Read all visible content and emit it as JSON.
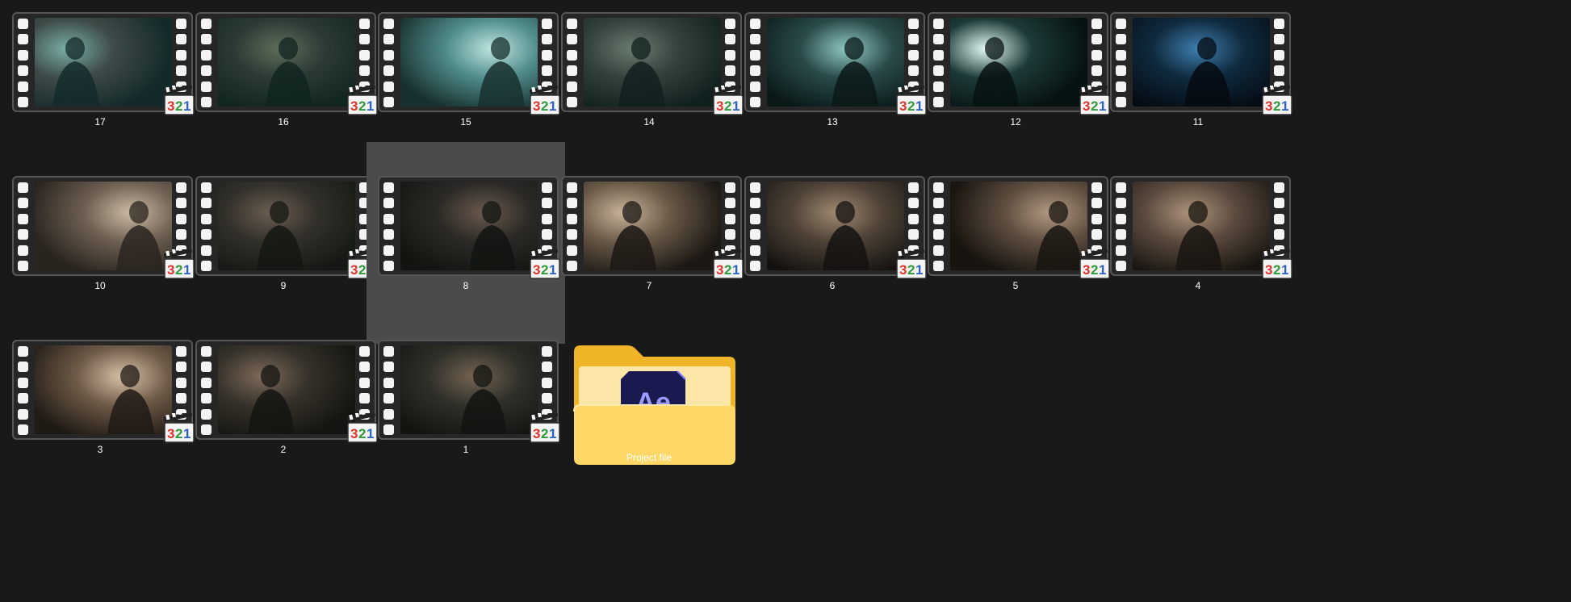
{
  "explorer": {
    "view": "large-icons",
    "items": [
      {
        "name": "17",
        "type": "video",
        "icon": "media-player-classic-321-icon",
        "tone": [
          "#142a2a",
          "#3e4a48",
          "#7ab0a8"
        ]
      },
      {
        "name": "16",
        "type": "video",
        "icon": "media-player-classic-321-icon",
        "tone": [
          "#102420",
          "#2b3a34",
          "#5e6e5a"
        ]
      },
      {
        "name": "15",
        "type": "video",
        "icon": "media-player-classic-321-icon",
        "tone": [
          "#18302f",
          "#4f8c8a",
          "#bfe6e2"
        ]
      },
      {
        "name": "14",
        "type": "video",
        "icon": "media-player-classic-321-icon",
        "tone": [
          "#10201e",
          "#33423c",
          "#6a7c70"
        ]
      },
      {
        "name": "13",
        "type": "video",
        "icon": "media-player-classic-321-icon",
        "tone": [
          "#0a1818",
          "#2a4a4a",
          "#8fc9c4"
        ]
      },
      {
        "name": "12",
        "type": "video",
        "icon": "media-player-classic-321-icon",
        "tone": [
          "#061212",
          "#1d3a38",
          "#e4fbf6"
        ]
      },
      {
        "name": "11",
        "type": "video",
        "icon": "media-player-classic-321-icon",
        "tone": [
          "#050b12",
          "#0f2a3e",
          "#3f7fb0"
        ]
      },
      {
        "name": "10",
        "type": "video",
        "icon": "media-player-classic-321-icon",
        "tone": [
          "#2a241e",
          "#6e6052",
          "#cdbba6"
        ]
      },
      {
        "name": "9",
        "type": "video",
        "icon": "media-player-classic-321-icon",
        "tone": [
          "#141812",
          "#32302a",
          "#6c5e52"
        ]
      },
      {
        "name": "8",
        "type": "video",
        "icon": "media-player-classic-321-icon",
        "tone": [
          "#121410",
          "#2c2a26",
          "#6a5a4e"
        ],
        "selected": true
      },
      {
        "name": "7",
        "type": "video",
        "icon": "media-player-classic-321-icon",
        "tone": [
          "#1c1814",
          "#6a5a48",
          "#c9b49a"
        ]
      },
      {
        "name": "6",
        "type": "video",
        "icon": "media-player-classic-321-icon",
        "tone": [
          "#141210",
          "#4e4236",
          "#a08a72"
        ]
      },
      {
        "name": "5",
        "type": "video",
        "icon": "media-player-classic-321-icon",
        "tone": [
          "#18140f",
          "#5e4e40",
          "#b39a82"
        ]
      },
      {
        "name": "4",
        "type": "video",
        "icon": "media-player-classic-321-icon",
        "tone": [
          "#18140f",
          "#5a4a3e",
          "#ad937c"
        ]
      },
      {
        "name": "3",
        "type": "video",
        "icon": "media-player-classic-321-icon",
        "tone": [
          "#201a14",
          "#6e5a48",
          "#d8c2a8"
        ]
      },
      {
        "name": "2",
        "type": "video",
        "icon": "media-player-classic-321-icon",
        "tone": [
          "#141410",
          "#36322a",
          "#7e6a5a"
        ]
      },
      {
        "name": "1",
        "type": "video",
        "icon": "media-player-classic-321-icon",
        "tone": [
          "#121410",
          "#30302a",
          "#746452"
        ]
      },
      {
        "name": "Project file",
        "type": "folder",
        "icon": "folder-after-effects-icon",
        "app_badge": "Ae"
      }
    ]
  },
  "colors": {
    "background": "#191919",
    "selection": "#4b4b4b",
    "label": "#ffffff",
    "folder_back": "#f0b429",
    "folder_front": "#ffd766",
    "ae_badge_bg": "#1a1950",
    "ae_badge_text": "#9b9bff"
  }
}
